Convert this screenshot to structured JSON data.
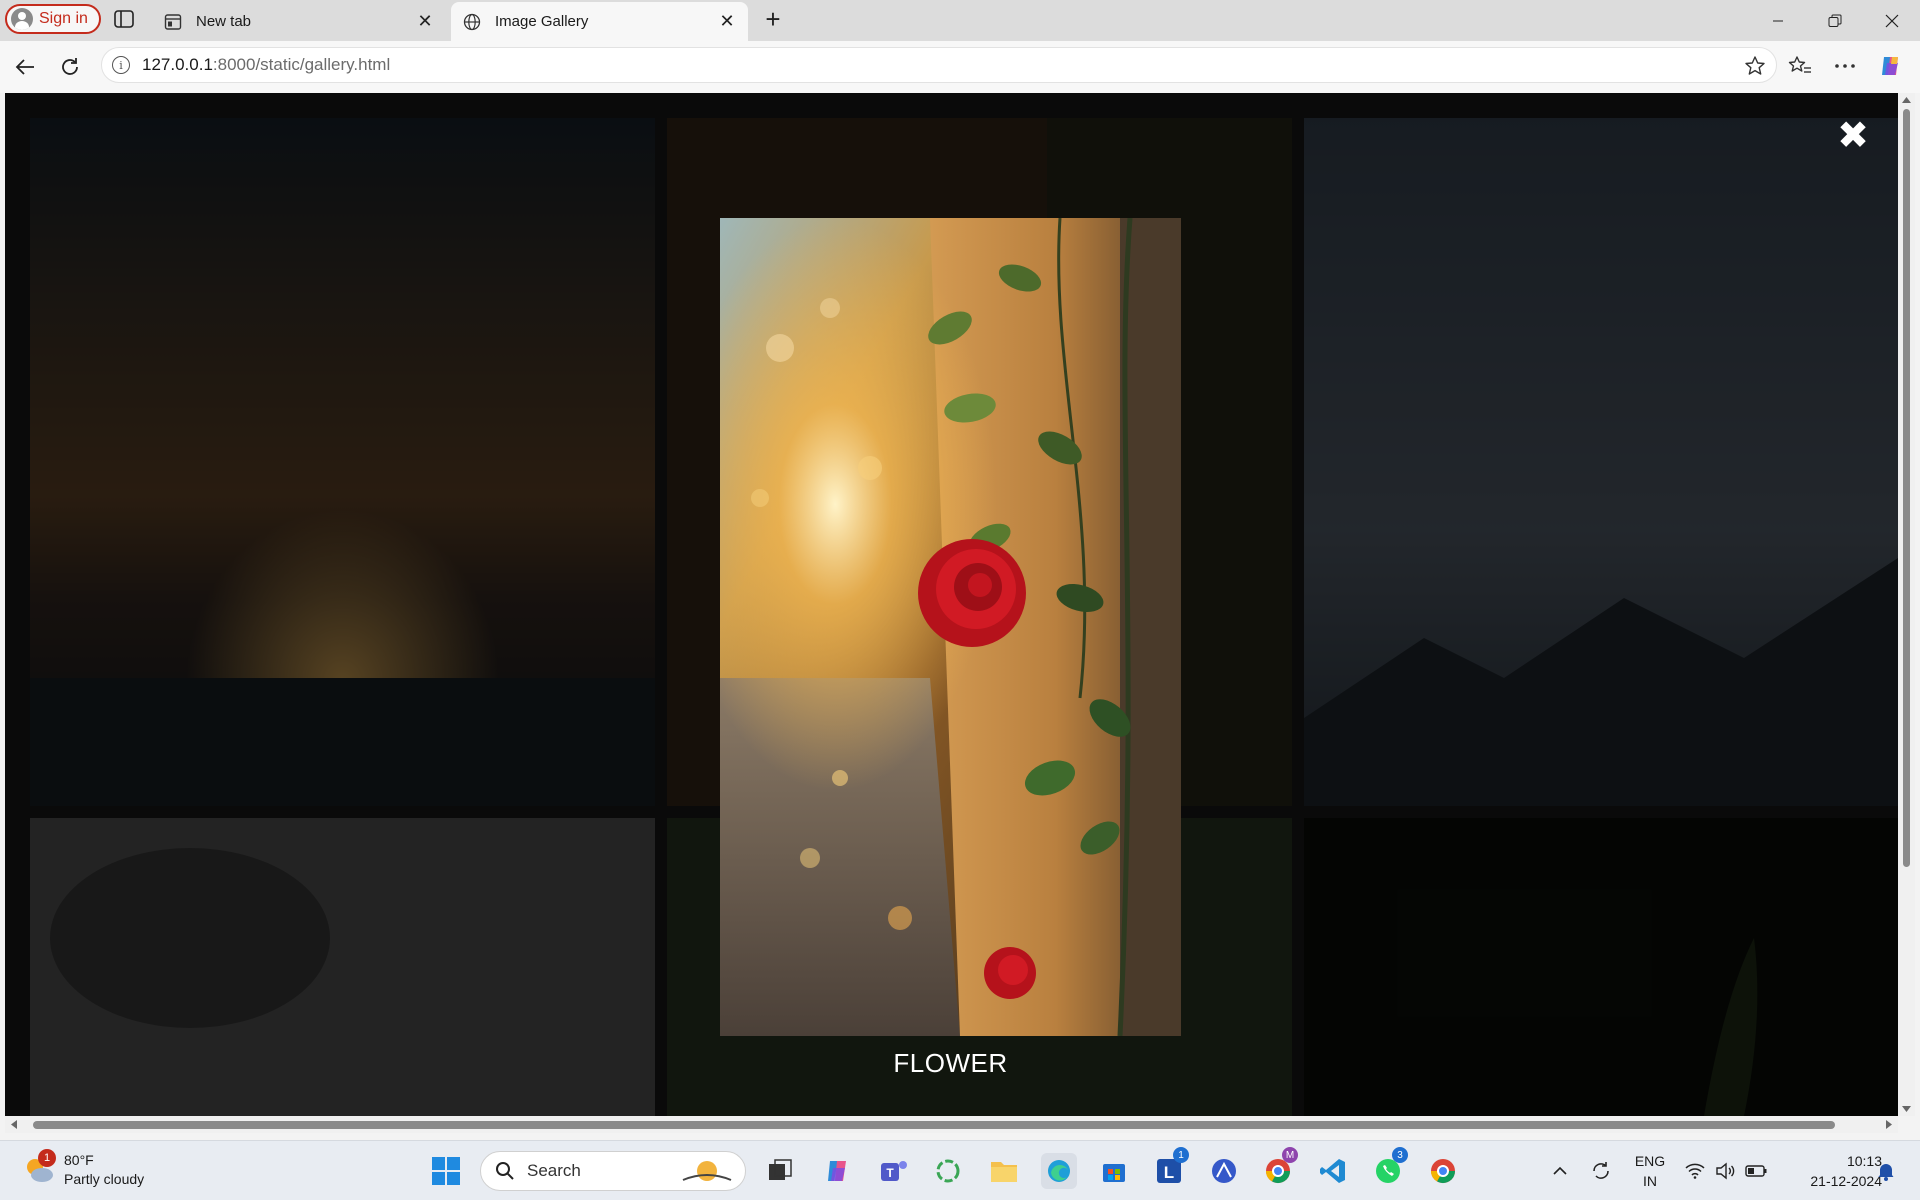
{
  "browser": {
    "signin_label": "Sign in",
    "tabs": [
      {
        "title": "New tab",
        "icon": "new-tab-page-icon",
        "active": false
      },
      {
        "title": "Image Gallery",
        "icon": "globe-icon",
        "active": true
      }
    ],
    "url_host": "127.0.0.1",
    "url_rest": ":8000/static/gallery.html"
  },
  "modal": {
    "caption": "FLOWER",
    "close_glyph": "✖"
  },
  "taskbar": {
    "weather": {
      "temp": "80°F",
      "condition": "Partly cloudy",
      "badge": "1"
    },
    "search_placeholder": "Search",
    "lang_top": "ENG",
    "lang_bottom": "IN",
    "time": "10:13",
    "date": "21-12-2024",
    "badges": {
      "l_app": "1",
      "chrome_profile": "M",
      "whatsapp": "3"
    }
  },
  "colors": {
    "signin_accent": "#c42b1c",
    "overlay": "rgba(0,0,0,0.62)",
    "taskbar_bg": "#e8ecf2"
  }
}
